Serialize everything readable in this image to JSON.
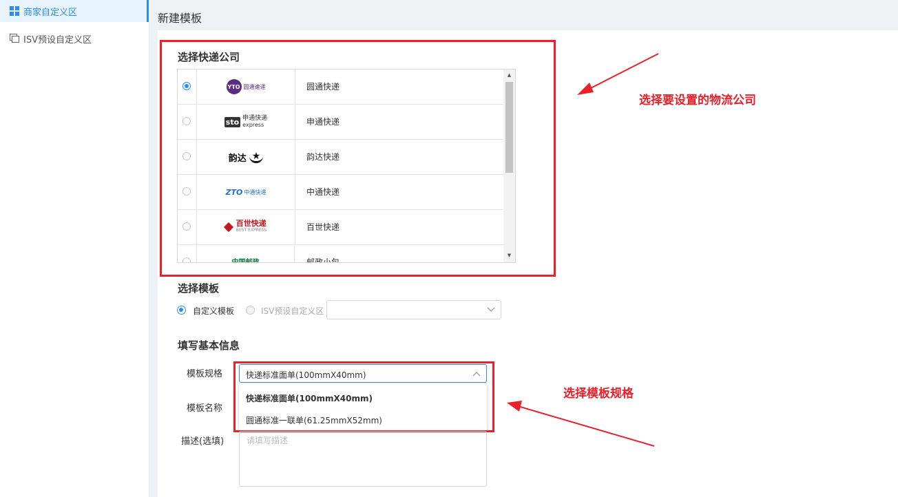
{
  "sidebar": {
    "items": [
      {
        "label": "商家自定义区",
        "active": true
      },
      {
        "label": "ISV预设自定义区",
        "active": false
      }
    ]
  },
  "header": {
    "title": "新建模板"
  },
  "courier_section": {
    "title": "选择快递公司",
    "rows": [
      {
        "logo_text": "圆通速递",
        "logo_mark": "YTO",
        "name": "圆通快递",
        "selected": true,
        "color": "#5b2d82"
      },
      {
        "logo_text": "申通快递",
        "logo_sub": "express",
        "logo_mark": "sto",
        "name": "申通快递",
        "selected": false,
        "color": "#333333"
      },
      {
        "logo_text": "韵达",
        "logo_mark": "★",
        "name": "韵达快递",
        "selected": false,
        "color": "#111111"
      },
      {
        "logo_text": "中通快递",
        "logo_mark": "ZTO",
        "name": "中通快递",
        "selected": false,
        "color": "#1e6fd9"
      },
      {
        "logo_text": "百世快递",
        "logo_sub": "BEST EXPRESS",
        "name": "百世快递",
        "selected": false,
        "color": "#c4161c"
      },
      {
        "logo_text": "中国邮政",
        "name": "邮政小包",
        "selected": false,
        "color": "#0b7a3e"
      }
    ]
  },
  "template_section": {
    "title": "选择模板",
    "option_custom": "自定义模板",
    "option_isv": "ISV预设自定义区"
  },
  "basic_info": {
    "title": "填写基本信息",
    "spec_label": "模板规格",
    "spec_value": "快递标准面单(100mmX40mm)",
    "name_label": "模板名称",
    "desc_label": "描述(选填)",
    "desc_placeholder": "请填写描述",
    "spec_options": [
      "快递标准面单(100mmX40mm)",
      "圆通标准一联单(61.25mmX52mm)"
    ]
  },
  "annotations": {
    "courier_callout": "选择要设置的物流公司",
    "spec_callout": "选择模板规格",
    "color": "#e8212b"
  }
}
